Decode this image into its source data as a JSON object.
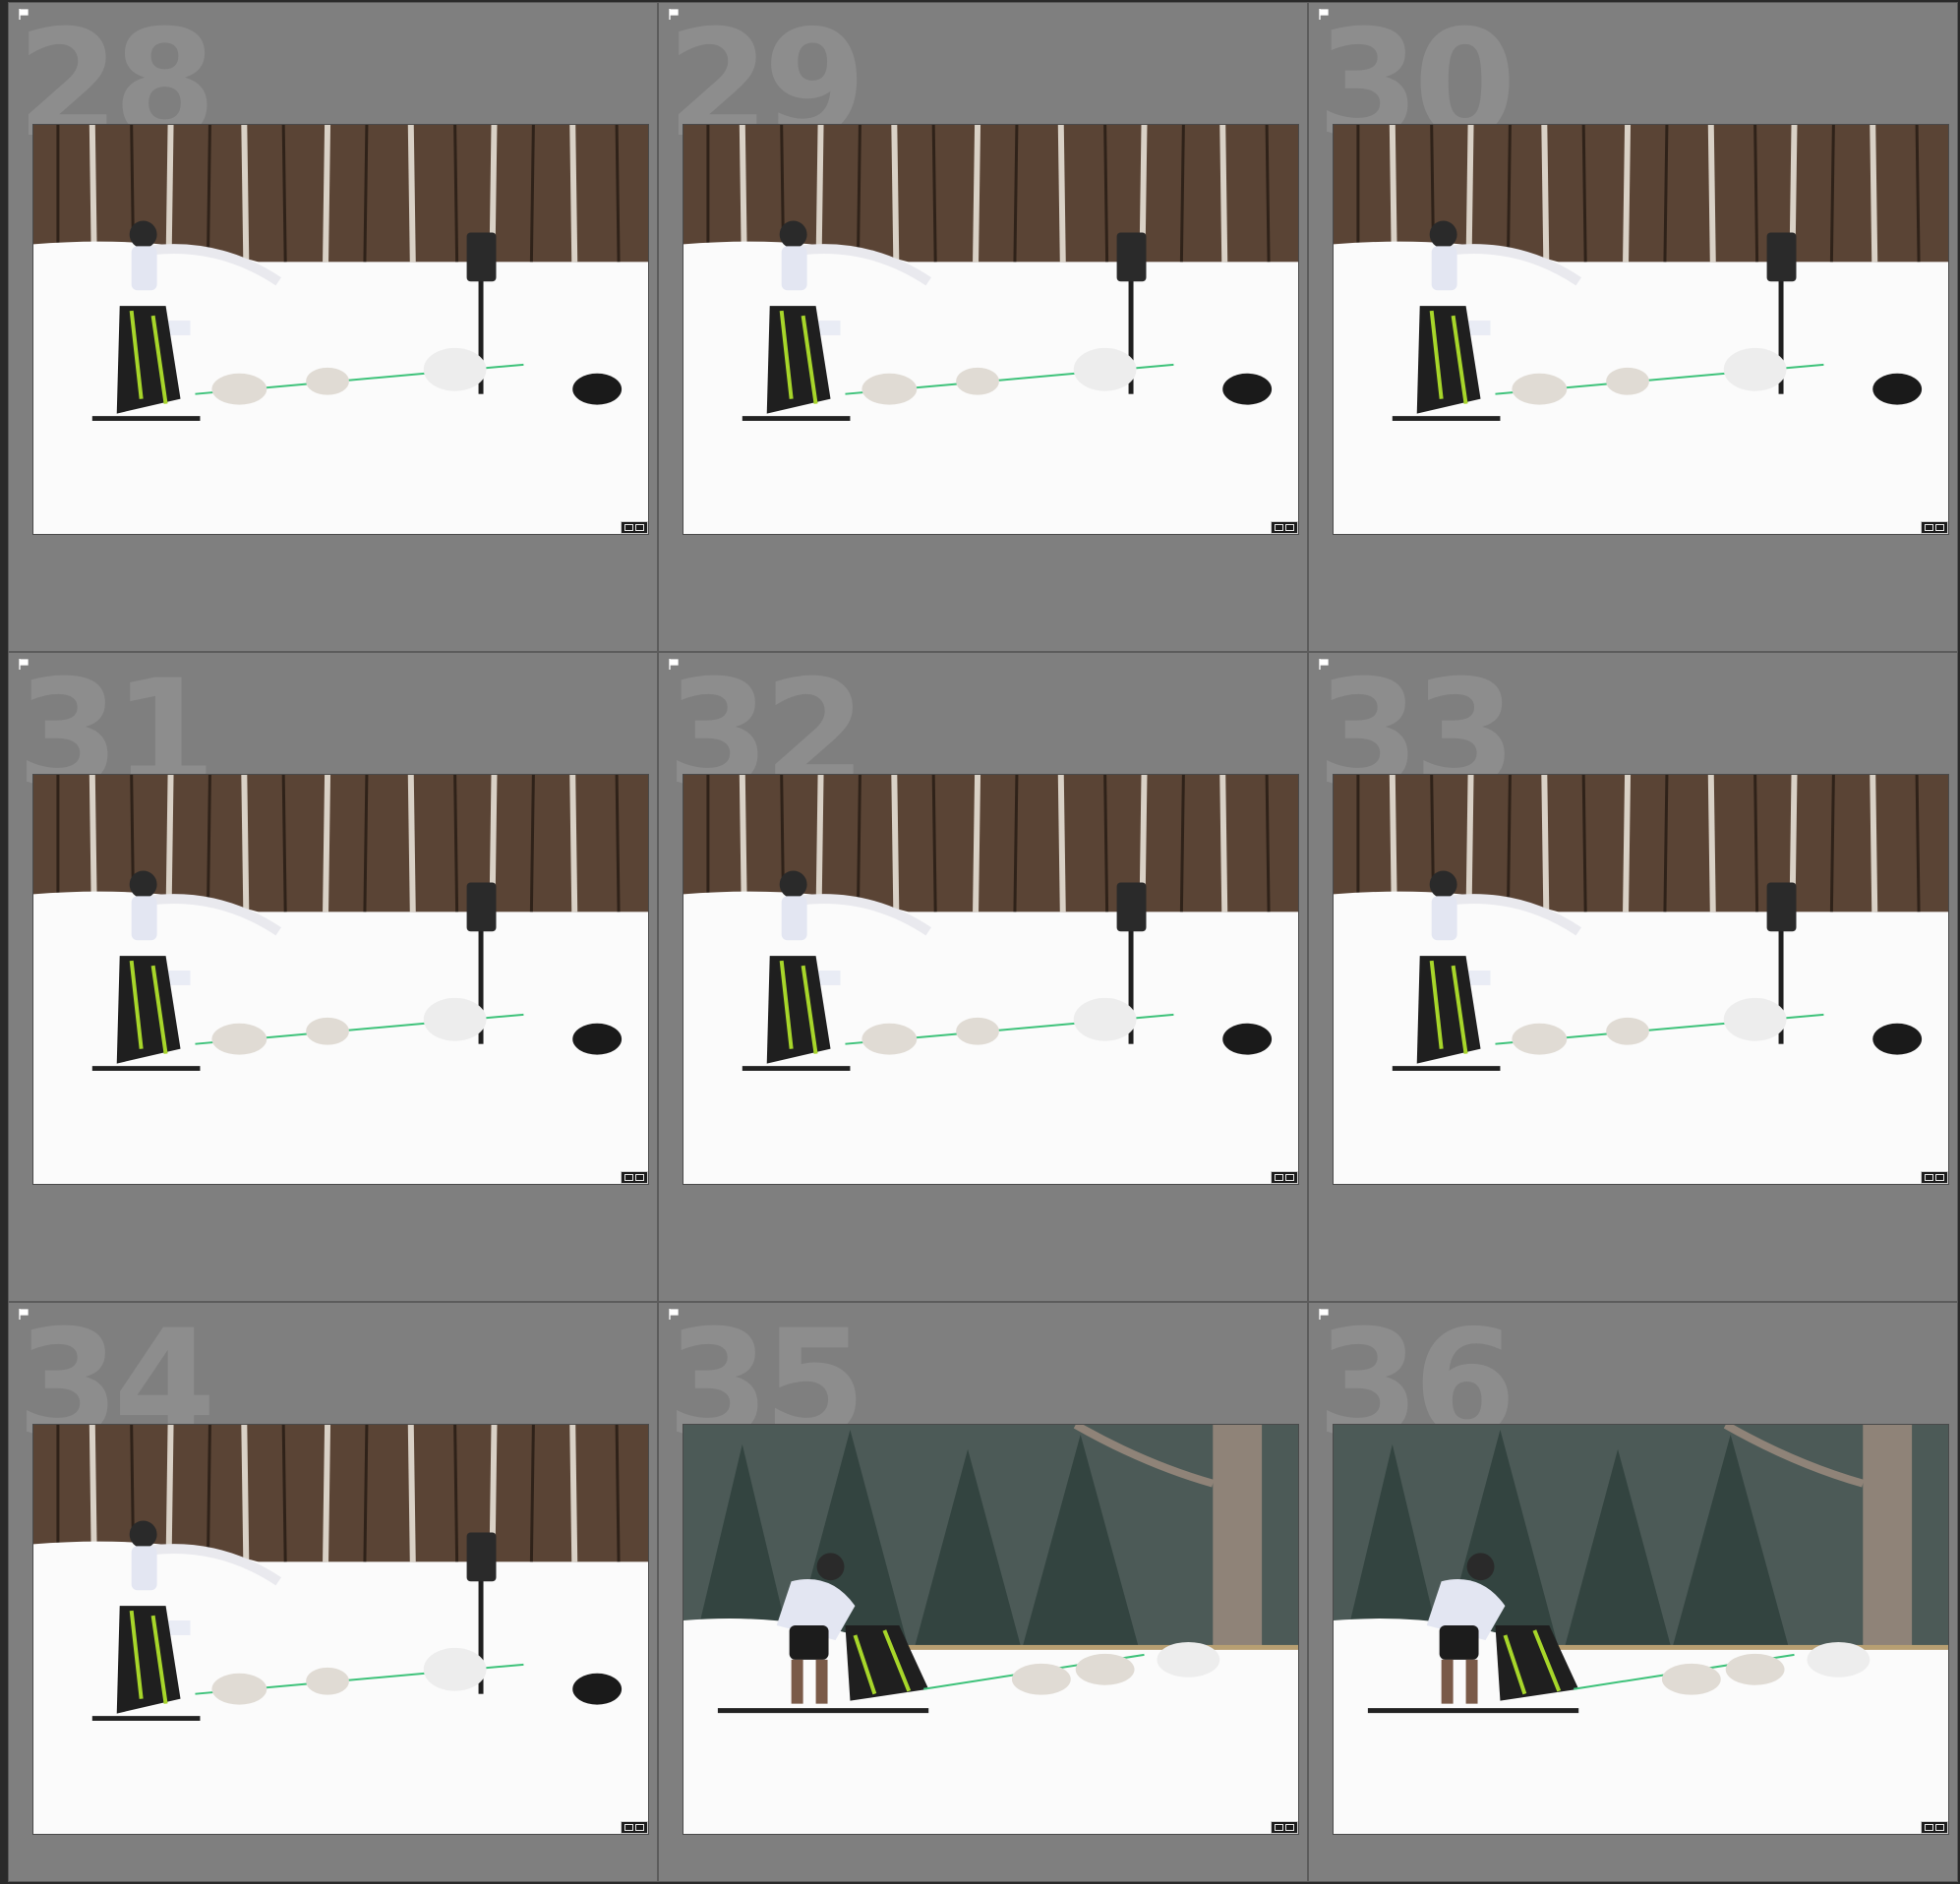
{
  "grid": {
    "cells": [
      {
        "number": "28",
        "scene": "forest"
      },
      {
        "number": "29",
        "scene": "forest"
      },
      {
        "number": "30",
        "scene": "forest"
      },
      {
        "number": "31",
        "scene": "forest"
      },
      {
        "number": "32",
        "scene": "forest"
      },
      {
        "number": "33",
        "scene": "forest"
      },
      {
        "number": "34",
        "scene": "forest"
      },
      {
        "number": "35",
        "scene": "spruce"
      },
      {
        "number": "36",
        "scene": "spruce"
      }
    ]
  },
  "colors": {
    "cell_bg": "#7f7f7f",
    "cell_border": "#5c5c5c",
    "index_number": "#8d8d8d",
    "snow": "#fbfbfb",
    "sled_accent": "#a7d62a"
  }
}
